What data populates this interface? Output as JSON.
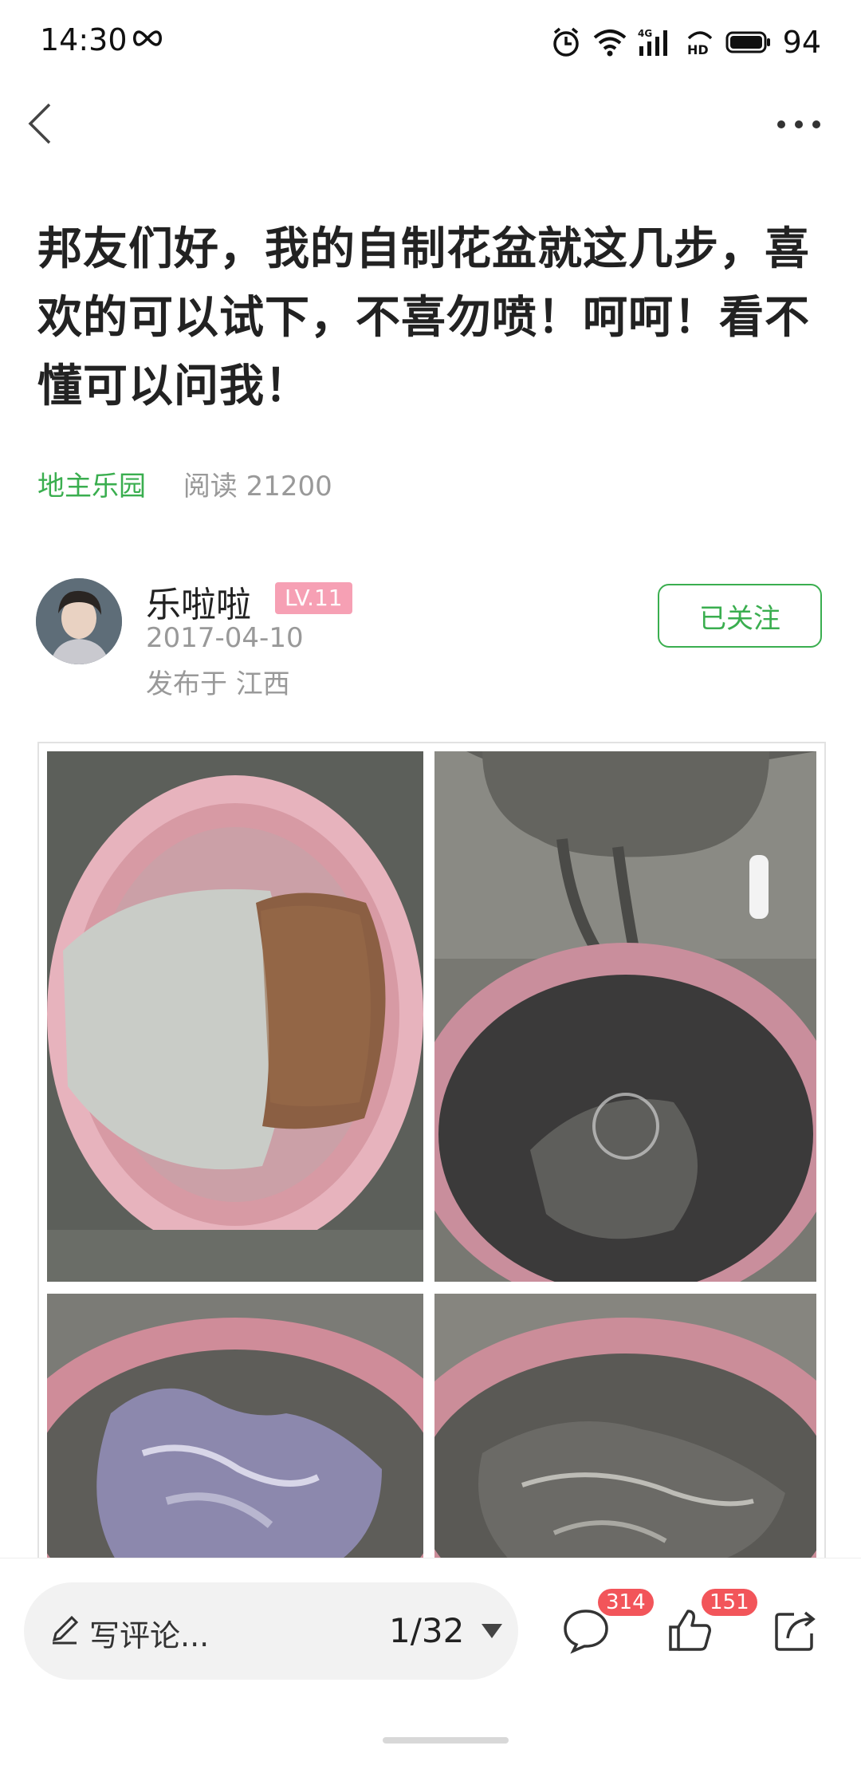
{
  "status_bar": {
    "time": "14:30",
    "icons": [
      "infinity-icon",
      "alarm-icon",
      "wifi-icon",
      "4g-signal-icon",
      "hd-icon",
      "battery-icon"
    ],
    "battery": "94"
  },
  "nav": {
    "back_icon": "back-icon",
    "more_icon": "more-icon"
  },
  "post": {
    "title": "邦友们好，我的自制花盆就这几步，喜欢的可以试下，不喜勿喷！呵呵！看不懂可以问我！",
    "circle_name": "地主乐园",
    "read_count": "阅读 21200"
  },
  "author": {
    "name": "乐啦啦",
    "level": "LV.11",
    "date": "2017-04-10",
    "location": "发布于 江西",
    "follow_label": "已关注"
  },
  "bottom_bar": {
    "comment_placeholder": "写评论...",
    "page_indicator": "1/32",
    "comment_count": "314",
    "like_count": "151"
  },
  "colors": {
    "accent": "#3aae4f",
    "badge": "#f2555a",
    "level": "#f6a0b4"
  }
}
